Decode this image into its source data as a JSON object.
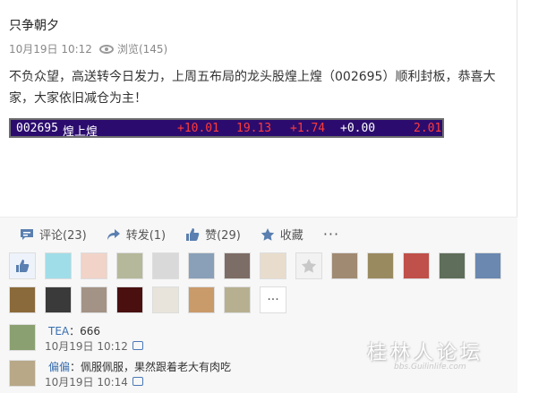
{
  "post": {
    "author": "只争朝夕",
    "time": "10月19日 10:12",
    "views": "浏览(145)",
    "content": "不负众望，高送转今日发力，上周五布局的龙头股煌上煌（002695）顺利封板，恭喜大家，大家依旧减仓为主！"
  },
  "quote": {
    "code": "002695",
    "name": "煌上煌",
    "change_pct": "+10.01",
    "price": "19.13",
    "change": "+1.74",
    "other": "+0.00",
    "turnover": "2.01",
    "colors": {
      "background": "#2b0c6e",
      "red": "#ff3b3b",
      "white": "#ffffff"
    }
  },
  "actions": {
    "comment": "评论(23)",
    "repost": "转发(1)",
    "like": "赞(29)",
    "favorite": "收藏",
    "more": "···"
  },
  "likers": {
    "more": "···",
    "icons": [
      "thumbs-up-icon"
    ]
  },
  "comments": [
    {
      "name": "TEA",
      "text": "：666",
      "time": "10月19日  10:12"
    },
    {
      "name": "偏偏",
      "text": "：佩服佩服，果然跟着老大有肉吃",
      "time": "10月19日  10:14"
    }
  ],
  "watermark": {
    "main": "桂林人论坛",
    "sub": "bbs.Guilinlife.com"
  }
}
